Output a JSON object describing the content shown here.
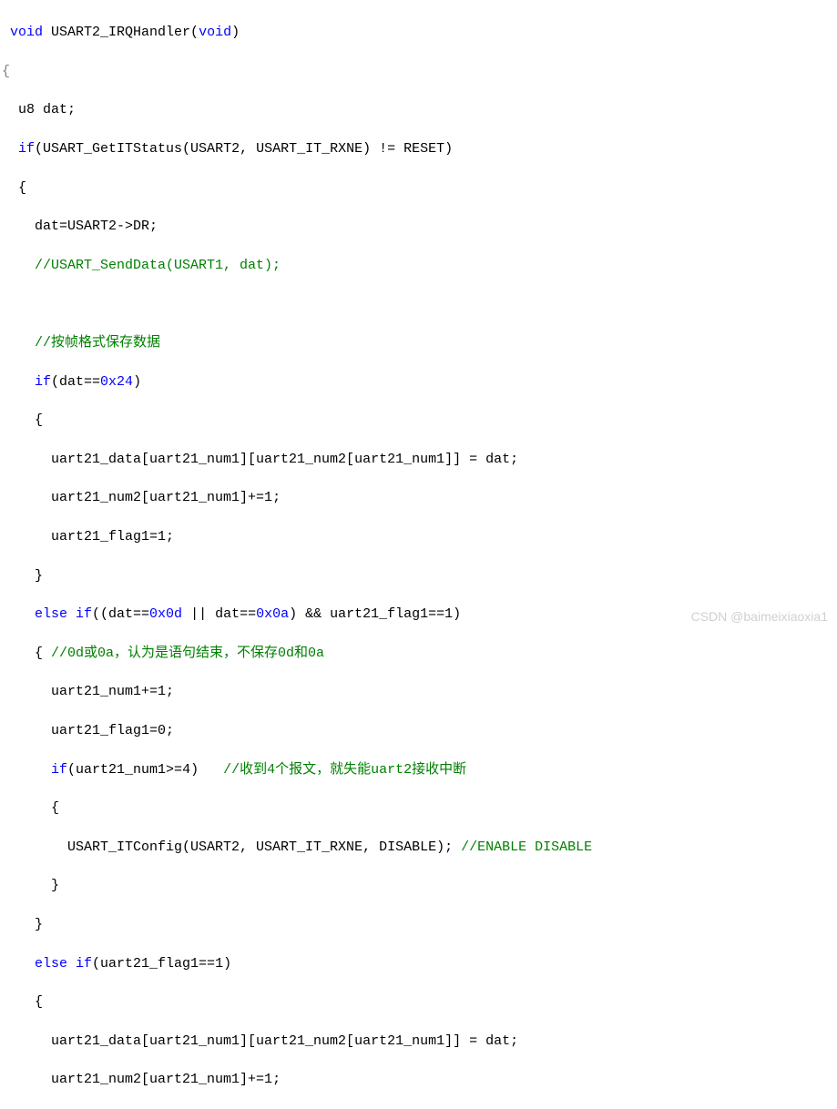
{
  "code": {
    "line1_void": "void",
    "line1_func": " USART2_IRQHandler(",
    "line1_void2": "void",
    "line1_end": ")",
    "line2": "{",
    "line3_u8": "  u8 dat;",
    "line4_if": "if",
    "line4_rest": "(USART_GetITStatus(USART2, USART_IT_RXNE) != RESET)",
    "line5": "  {",
    "line6": "    dat=USART2->DR;",
    "line7": "//USART_SendData(USART1, dat);",
    "line8": "",
    "line9": "//按帧格式保存数据",
    "line10_if": "if",
    "line10_paren": "(dat==",
    "line10_hex": "0x24",
    "line10_end": ")",
    "line11": "    {",
    "line12": "      uart21_data[uart21_num1][uart21_num2[uart21_num1]] = dat;",
    "line13_a": "      uart21_num2[uart21_num1]+=",
    "line13_num": "1",
    "line13_b": ";",
    "line14_a": "      uart21_flag1=",
    "line14_num": "1",
    "line14_b": ";",
    "line15": "    }",
    "line16_else": "else if",
    "line16_a": "((dat==",
    "line16_hex1": "0x0d",
    "line16_b": " || dat==",
    "line16_hex2": "0x0a",
    "line16_c": ") && uart21_flag1==",
    "line16_num": "1",
    "line16_d": ")",
    "line17_brace": "    { ",
    "line17_comment": "//0d或0a，认为是语句结束，不保存0d和0a",
    "line18_a": "      uart21_num1+=",
    "line18_num": "1",
    "line18_b": ";",
    "line19_a": "      uart21_flag1=",
    "line19_num": "0",
    "line19_b": ";",
    "line20_if": "if",
    "line20_a": "(uart21_num1>=",
    "line20_num": "4",
    "line20_b": ")   ",
    "line20_comment": "//收到4个报文，就失能uart2接收中断",
    "line21": "      {",
    "line22_a": "        USART_ITConfig(USART2, USART_IT_RXNE, DISABLE); ",
    "line22_comment": "//ENABLE DISABLE",
    "line23": "      }",
    "line24": "    }",
    "line25_else": "else if",
    "line25_a": "(uart21_flag1==",
    "line25_num": "1",
    "line25_b": ")",
    "line26": "    {",
    "line27": "      uart21_data[uart21_num1][uart21_num2[uart21_num1]] = dat;",
    "line28_a": "      uart21_num2[uart21_num1]+=",
    "line28_num": "1",
    "line28_b": ";"
  },
  "watermark": "CSDN @baimeixiaoxia1"
}
